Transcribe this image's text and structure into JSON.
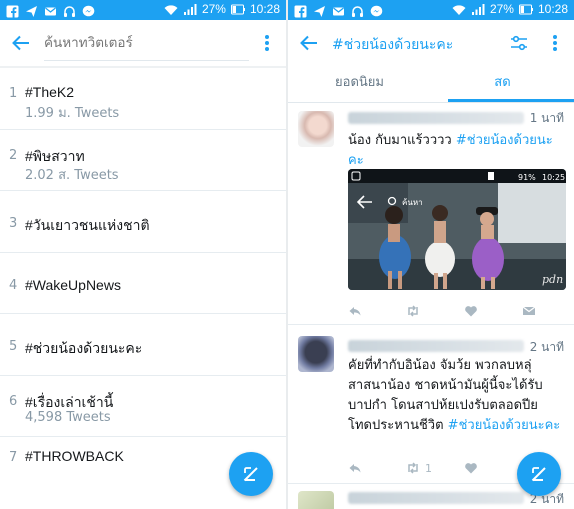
{
  "statusbar": {
    "battery": "27%",
    "time": "10:28"
  },
  "left": {
    "search": {
      "placeholder": "ค้นหาทวิตเตอร์"
    },
    "trends": [
      {
        "rank": "1",
        "name": "#TheK2",
        "count": "1.99 ม. Tweets"
      },
      {
        "rank": "2",
        "name": "#พิษสวาท",
        "count": "2.02 ส. Tweets"
      },
      {
        "rank": "3",
        "name": "#วันเยาวชนแห่งชาติ",
        "count": ""
      },
      {
        "rank": "4",
        "name": "#WakeUpNews",
        "count": ""
      },
      {
        "rank": "5",
        "name": "#ช่วยน้องด้วยนะคะ",
        "count": ""
      },
      {
        "rank": "6",
        "name": "#เรื่องเล่าเช้านี้",
        "count": "4,598 Tweets"
      },
      {
        "rank": "7",
        "name": "#THROWBACK",
        "count": ""
      }
    ]
  },
  "right": {
    "title": "#ช่วยน้องด้วยนะคะ",
    "tabs": {
      "top": "ยอดนิยม",
      "live": "สด"
    },
    "tweets": [
      {
        "time": "1 นาที",
        "text": "น้อง กับมาแร้วววว ",
        "hashtag": "#ช่วยน้องด้วยนะคะ"
      },
      {
        "time": "2 นาที",
        "text": "คัยที่ทำกับอิน้อง จัมว้ย พวกลบหลุ่สาสนาน้อง ชาดหน้ามันผู้นี้จะได้รับบาปกำ โดนสาปห้ยเปงรับตลอดปีย โทดประหานชีวิต ",
        "hashtag": "#ช่วยน้องด้วยนะคะ",
        "retweets": "1"
      },
      {
        "time": "2 นาที"
      }
    ],
    "media": {
      "battery": "91%",
      "time": "10:25",
      "search_hint": "ค้นหา",
      "watermark": "pdn"
    }
  }
}
